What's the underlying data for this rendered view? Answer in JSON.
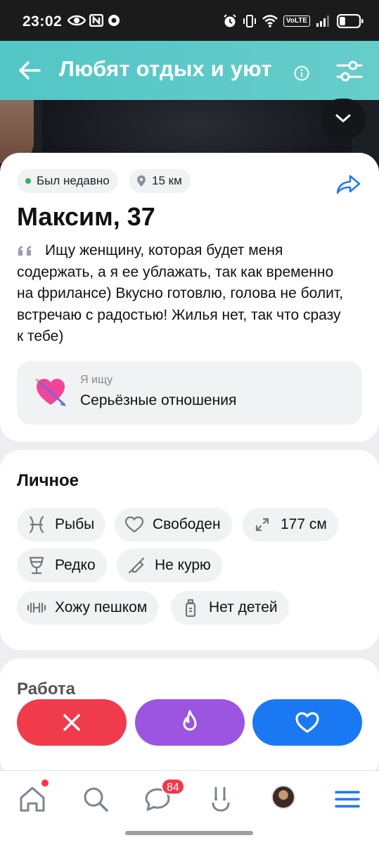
{
  "status_bar": {
    "time": "23:02",
    "volte": "VoLTE",
    "battery_level": 0.3
  },
  "app_bar": {
    "title": "Любят отдых и уют",
    "back_icon": "arrow-left-icon",
    "info_icon": "info-icon",
    "filters_icon": "filters-icon"
  },
  "profile": {
    "online_status": "Был недавно",
    "distance": "15 км",
    "name_age": "Максим, 37",
    "bio": "Ищу женщину, которая будет меня содержать, а я ее ублажать, так как временно на фрилансе) Вкусно готовлю, голова не болит, встречаю с радостью! Жилья нет, так что сразу к тебе)",
    "looking_for_label": "Я ищу",
    "looking_for_value": "Серьёзные отношения"
  },
  "personal": {
    "title": "Личное",
    "tags": [
      {
        "label": "Рыбы",
        "icon": "pisces-icon"
      },
      {
        "label": "Свободен",
        "icon": "heart-outline-icon"
      },
      {
        "label": "177 см",
        "icon": "height-arrows-icon"
      },
      {
        "label": "Редко",
        "icon": "wine-glass-icon"
      },
      {
        "label": "Не курю",
        "icon": "no-smoking-icon"
      },
      {
        "label": "Хожу пешком",
        "icon": "dumbbell-icon"
      },
      {
        "label": "Нет детей",
        "icon": "baby-bottle-icon"
      }
    ]
  },
  "work": {
    "title": "Работа"
  },
  "actions": {
    "dislike_icon": "close-icon",
    "super_icon": "fire-icon",
    "like_icon": "heart-icon"
  },
  "bottom_nav": {
    "messages_badge": "84",
    "items": [
      "home-icon",
      "search-icon",
      "messages-icon",
      "likes-icon",
      "avatar",
      "menu-icon"
    ]
  },
  "colors": {
    "app_bar": "#5ec9c8",
    "dislike": "#f03b4c",
    "super": "#9c55e0",
    "like": "#1a79f2",
    "nav_accent": "#1a79f2",
    "online": "#34b35a"
  }
}
